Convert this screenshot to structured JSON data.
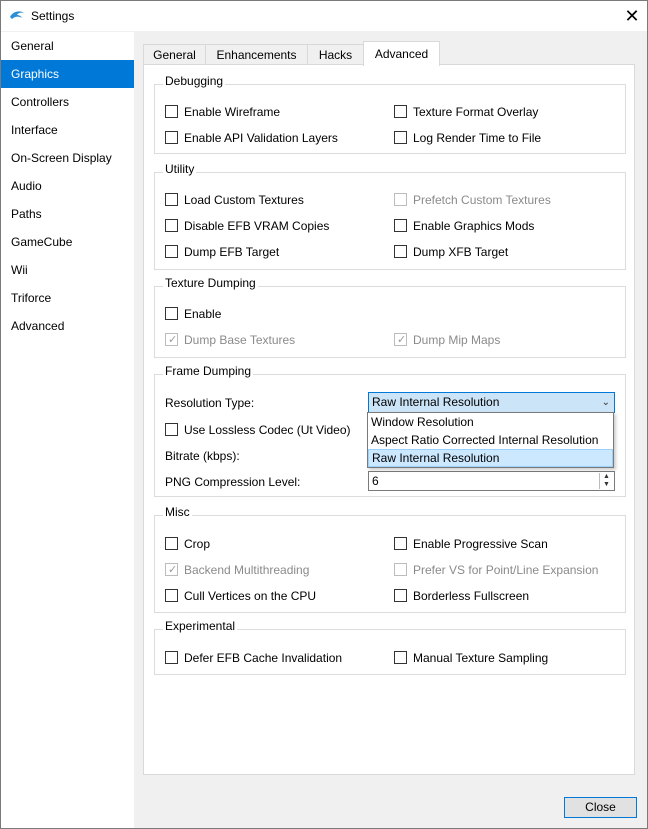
{
  "window": {
    "title": "Settings"
  },
  "sidebar": {
    "items": [
      {
        "label": "General"
      },
      {
        "label": "Graphics"
      },
      {
        "label": "Controllers"
      },
      {
        "label": "Interface"
      },
      {
        "label": "On-Screen Display"
      },
      {
        "label": "Audio"
      },
      {
        "label": "Paths"
      },
      {
        "label": "GameCube"
      },
      {
        "label": "Wii"
      },
      {
        "label": "Triforce"
      },
      {
        "label": "Advanced"
      }
    ],
    "selected": "Graphics"
  },
  "tabs": [
    {
      "label": "General"
    },
    {
      "label": "Enhancements"
    },
    {
      "label": "Hacks"
    },
    {
      "label": "Advanced"
    }
  ],
  "active_tab": "Advanced",
  "debugging": {
    "title": "Debugging",
    "enable_wireframe": "Enable Wireframe",
    "texture_format_overlay": "Texture Format Overlay",
    "enable_api_validation": "Enable API Validation Layers",
    "log_render_time": "Log Render Time to File"
  },
  "utility": {
    "title": "Utility",
    "load_custom_textures": "Load Custom Textures",
    "prefetch_custom_textures": "Prefetch Custom Textures",
    "disable_efb_vram": "Disable EFB VRAM Copies",
    "enable_graphics_mods": "Enable Graphics Mods",
    "dump_efb_target": "Dump EFB Target",
    "dump_xfb_target": "Dump XFB Target"
  },
  "texture_dumping": {
    "title": "Texture Dumping",
    "enable": "Enable",
    "dump_base_textures": "Dump Base Textures",
    "dump_mip_maps": "Dump Mip Maps"
  },
  "frame_dumping": {
    "title": "Frame Dumping",
    "resolution_type_label": "Resolution Type:",
    "resolution_type_value": "Raw Internal Resolution",
    "resolution_options": [
      "Window Resolution",
      "Aspect Ratio Corrected Internal Resolution",
      "Raw Internal Resolution"
    ],
    "lossless_codec": "Use Lossless Codec (Ut Video)",
    "bitrate_label": "Bitrate (kbps):",
    "png_label": "PNG Compression Level:",
    "png_value": "6"
  },
  "misc": {
    "title": "Misc",
    "crop": "Crop",
    "progressive_scan": "Enable Progressive Scan",
    "backend_multithreading": "Backend Multithreading",
    "prefer_vs": "Prefer VS for Point/Line Expansion",
    "cull_vertices": "Cull Vertices on the CPU",
    "borderless_fullscreen": "Borderless Fullscreen"
  },
  "experimental": {
    "title": "Experimental",
    "defer_efb": "Defer EFB Cache Invalidation",
    "manual_texture_sampling": "Manual Texture Sampling"
  },
  "buttons": {
    "close": "Close"
  },
  "colors": {
    "accent": "#0078d7",
    "selection": "#cce8ff"
  }
}
